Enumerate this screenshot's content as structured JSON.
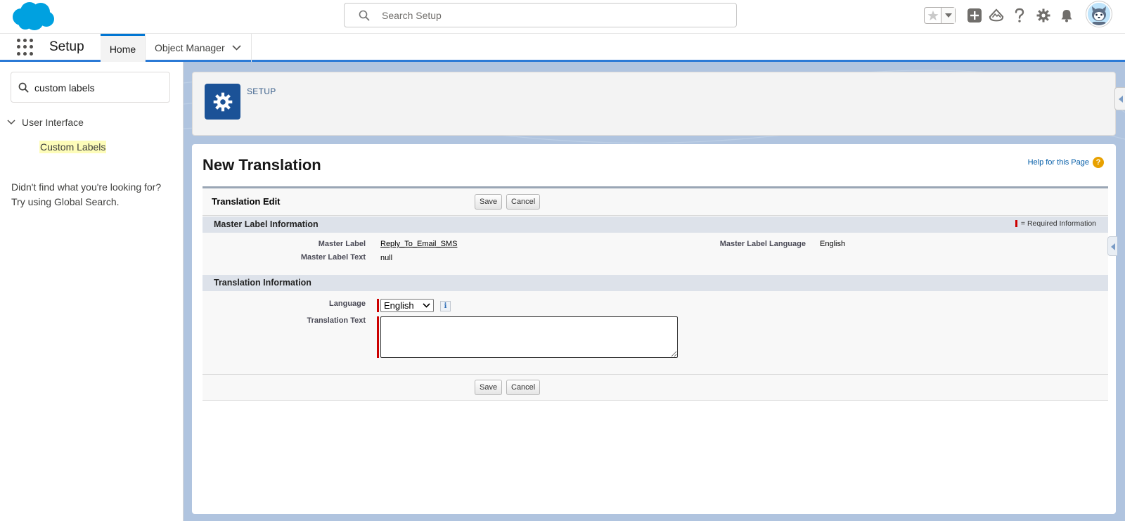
{
  "header": {
    "search_placeholder": "Search Setup",
    "icons": [
      "favorites-star-icon",
      "favorites-dropdown-icon",
      "global-actions-icon",
      "trailhead-icon",
      "help-icon",
      "setup-gear-icon",
      "notifications-bell-icon",
      "user-avatar"
    ],
    "brand_color": "#00a1e0"
  },
  "nav": {
    "app_name": "Setup",
    "tabs": [
      {
        "label": "Home",
        "active": true
      },
      {
        "label": "Object Manager",
        "active": false
      }
    ]
  },
  "sidebar": {
    "quick_find_value": "custom labels",
    "tree_parent": "User Interface",
    "tree_child": "Custom Labels",
    "not_found_line1": "Didn't find what you're looking for?",
    "not_found_line2": "Try using Global Search."
  },
  "setup_header": {
    "label": "SETUP"
  },
  "page": {
    "title": "New Translation",
    "help_link": "Help for this Page",
    "help_icon_glyph": "?"
  },
  "form": {
    "block_title": "Translation Edit",
    "save_label": "Save",
    "cancel_label": "Cancel",
    "master_section": {
      "title": "Master Label Information",
      "required_legend": "= Required Information",
      "master_label_label": "Master Label",
      "master_label_value": "Reply_To_Email_SMS",
      "master_text_label": "Master Label Text",
      "master_text_value": "null",
      "master_lang_label": "Master Label Language",
      "master_lang_value": "English"
    },
    "translation_section": {
      "title": "Translation Information",
      "language_label": "Language",
      "language_value": "English",
      "info_glyph": "i",
      "translation_text_label": "Translation Text",
      "translation_text_value": ""
    }
  }
}
